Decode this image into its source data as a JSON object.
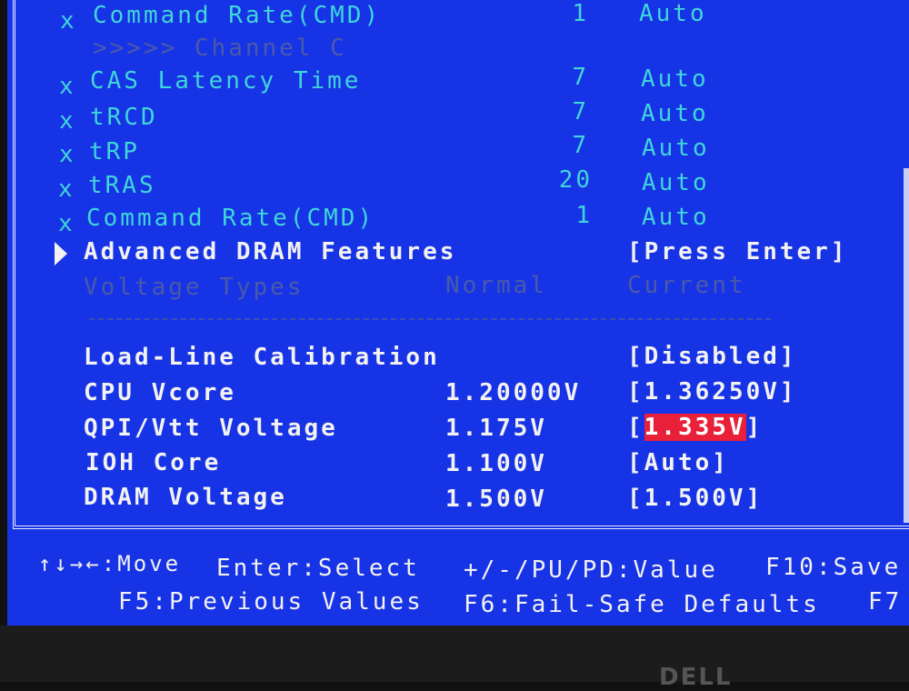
{
  "timing_rows": [
    {
      "label": "Command Rate(CMD)",
      "value": "1",
      "setting": "Auto"
    },
    {
      "label": "CAS Latency Time",
      "value": "7",
      "setting": "Auto"
    },
    {
      "label": "tRCD",
      "value": "7",
      "setting": "Auto"
    },
    {
      "label": "tRP",
      "value": "7",
      "setting": "Auto"
    },
    {
      "label": "tRAS",
      "value": "20",
      "setting": "Auto"
    },
    {
      "label": "Command Rate(CMD)",
      "value": "1",
      "setting": "Auto"
    }
  ],
  "disabled_mark": "x",
  "channel_header": ">>>>> Channel C",
  "advanced": {
    "label": "Advanced DRAM Features",
    "action": "[Press Enter]",
    "icon": "triangle-right-icon"
  },
  "voltage_header": {
    "label": "Voltage Types",
    "normal": "Normal",
    "current": "Current"
  },
  "voltage_rows": [
    {
      "label": "Load-Line Calibration",
      "normal": "",
      "current": "[Disabled]"
    },
    {
      "label": "CPU Vcore",
      "normal": "1.20000V",
      "current": "[1.36250V]"
    },
    {
      "label": "QPI/Vtt Voltage",
      "normal": "1.175V",
      "current_open": "[",
      "current": "1.335V",
      "current_close": "]"
    },
    {
      "label": "IOH Core",
      "normal": "1.100V",
      "current": "[Auto]"
    },
    {
      "label": "DRAM Voltage",
      "normal": "1.500V",
      "current": "[1.500V]"
    }
  ],
  "help": {
    "row1": [
      "↑↓→←:Move",
      "Enter:Select",
      "+/-/PU/PD:Value",
      "F10:Save"
    ],
    "row2": [
      "F5:Previous Values",
      "F6:Fail-Safe Defaults",
      "F7"
    ]
  },
  "bezel_logo": "DELL",
  "colors": {
    "background": "#1733e6",
    "text_active": "#f2f2f2",
    "text_disabled": "#3fd6d8",
    "highlight": "#e8203a"
  }
}
